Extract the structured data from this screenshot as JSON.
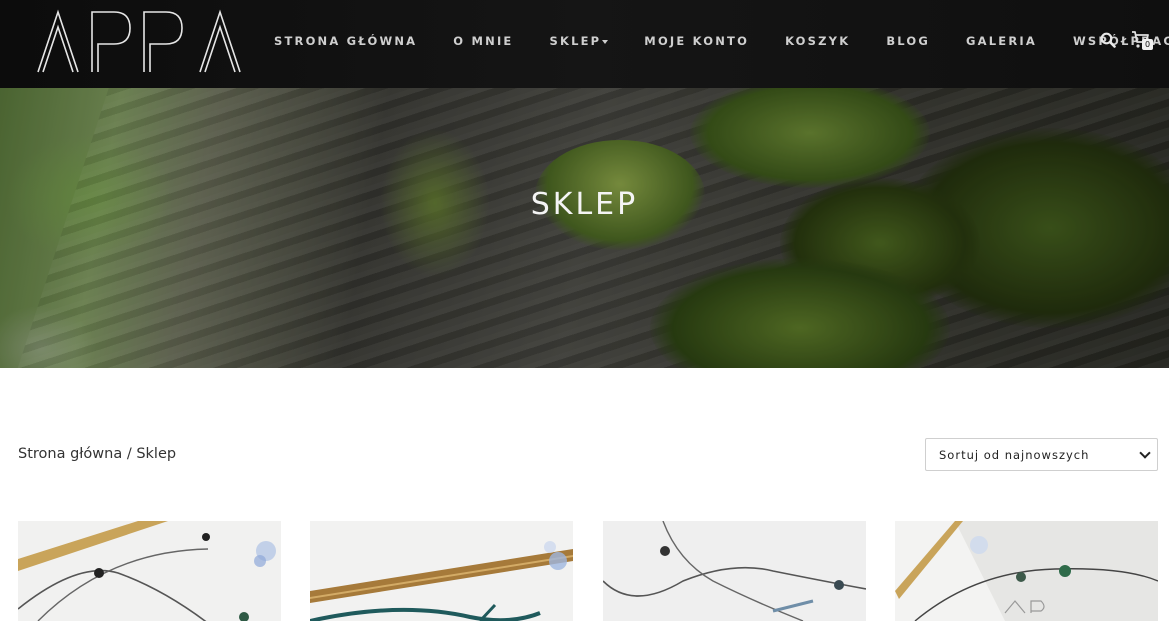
{
  "header": {
    "logo_text": "APPA",
    "nav": [
      {
        "label": "STRONA GŁÓWNA"
      },
      {
        "label": "O MNIE"
      },
      {
        "label": "SKLEP"
      },
      {
        "label": "MOJE KONTO"
      },
      {
        "label": "KOSZYK"
      },
      {
        "label": "BLOG"
      },
      {
        "label": "GALERIA"
      },
      {
        "label": "WSPÓŁPRACA"
      }
    ],
    "cart_count": "0",
    "icons": [
      "search-icon",
      "cart-icon",
      "chevron-down-icon"
    ]
  },
  "hero": {
    "title": "SKLEP"
  },
  "breadcrumb": {
    "home": "Strona główna",
    "separator": " / ",
    "current": "Sklep"
  },
  "sort": {
    "selected": "Sortuj od najnowszych"
  },
  "colors": {
    "header_bg": "#111111",
    "nav_text": "#cfcfcf",
    "page_bg": "#ffffff"
  }
}
